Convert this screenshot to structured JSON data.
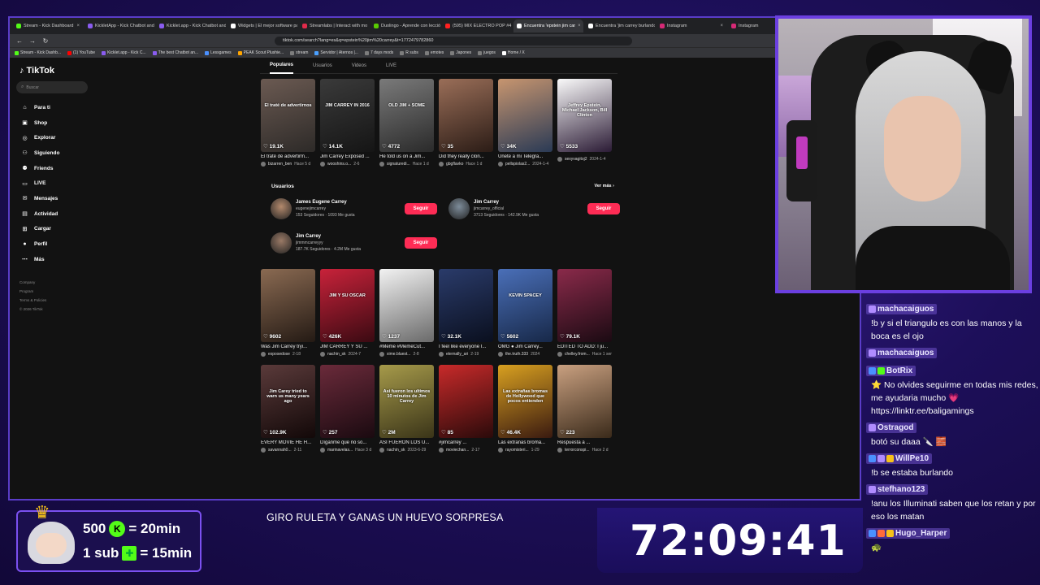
{
  "browser": {
    "tabs": [
      {
        "label": "Stream - Kick Dashboard",
        "color": "#53fc18"
      },
      {
        "label": "KickletApp - Kick Chatbot and",
        "color": "#8a5cf0"
      },
      {
        "label": "Kicklet.app - Kick Chatbot and",
        "color": "#8a5cf0"
      },
      {
        "label": "Widgets | El mejor software pa",
        "color": "#ffffff"
      },
      {
        "label": "Streamlabs | Interact with mo",
        "color": "#e02a4a"
      },
      {
        "label": "Duolingo - Aprende con lecció",
        "color": "#58cc02"
      },
      {
        "label": "(595) MIX ELECTRO POP #4 (S",
        "color": "#ff2020"
      },
      {
        "label": "Encuentra 'epstein jim car",
        "color": "#ffffff",
        "active": true
      },
      {
        "label": "Encuentra 'jim carrey burlando",
        "color": "#ffffff"
      },
      {
        "label": "Instagram",
        "color": "#d62976"
      },
      {
        "label": "Instagram",
        "color": "#d62976"
      }
    ],
    "url": "tiktok.com/search?lang=es&q=epstein%20jim%20carrey&t=1772479782860",
    "nav": {
      "back": "←",
      "forward": "→",
      "reload": "↻"
    },
    "bookmarks": [
      {
        "label": "Stream - Kick Dashb..."
      },
      {
        "label": "(1) YouTube"
      },
      {
        "label": "Kicklet.app - Kick C..."
      },
      {
        "label": "The best Chatbot an..."
      },
      {
        "label": "Lessgames"
      },
      {
        "label": "PEAK Scout Plushie..."
      },
      {
        "label": "stream"
      },
      {
        "label": "Servidor | Aternos |..."
      },
      {
        "label": "7 days mods"
      },
      {
        "label": "R subs"
      },
      {
        "label": "emotes"
      },
      {
        "label": "Japones"
      },
      {
        "label": "juegos"
      },
      {
        "label": "Home / X"
      }
    ]
  },
  "tiktok": {
    "logo": "TikTok",
    "search_placeholder": "Buscar",
    "nav": [
      {
        "label": "Para ti",
        "icon": "home-icon",
        "glyph": "⌂"
      },
      {
        "label": "Shop",
        "icon": "shop-icon",
        "glyph": "▣"
      },
      {
        "label": "Explorar",
        "icon": "compass-icon",
        "glyph": "◎"
      },
      {
        "label": "Siguiendo",
        "icon": "following-icon",
        "glyph": "⚇"
      },
      {
        "label": "Friends",
        "icon": "friends-icon",
        "glyph": "⚉"
      },
      {
        "label": "LIVE",
        "icon": "live-icon",
        "glyph": "▭"
      },
      {
        "label": "Mensajes",
        "icon": "messages-icon",
        "glyph": "✉"
      },
      {
        "label": "Actividad",
        "icon": "activity-icon",
        "glyph": "▤"
      },
      {
        "label": "Cargar",
        "icon": "upload-icon",
        "glyph": "⊞"
      },
      {
        "label": "Perfil",
        "icon": "profile-icon",
        "glyph": "●"
      },
      {
        "label": "Más",
        "icon": "more-icon",
        "glyph": "⋯"
      }
    ],
    "footer": [
      "Company",
      "Program",
      "Terms & Policies",
      "© 2026 TikTok"
    ],
    "tabs": [
      "Populares",
      "Usuarios",
      "Videos",
      "LIVE"
    ],
    "row1": [
      {
        "count": "19.1K",
        "title": "El traté de advertirm...",
        "author": "bizarren_ben",
        "date": "Hace 5 d",
        "overlay": "El traté de advertirnos",
        "c1": "#6b5a52",
        "c2": "#2d2a28"
      },
      {
        "count": "14.1K",
        "title": "Jim Carrey Exposed ...",
        "author": "wooshins.o...",
        "date": "2-6",
        "overlay": "JIM CARREY IN 2016",
        "c1": "#3a3a3a",
        "c2": "#151515"
      },
      {
        "count": "4772",
        "title": "He told us on a Jim...",
        "author": "signaturedi...",
        "date": "Hace 1 d",
        "overlay": "OLD JIM + SOME",
        "c1": "#7a7a7a",
        "c2": "#2a2a2a"
      },
      {
        "count": "35",
        "title": "Did they really clon...",
        "author": "gbgflavko",
        "date": "Hace 1 d",
        "overlay": "",
        "c1": "#9a6e58",
        "c2": "#2b1c16"
      },
      {
        "count": "34K",
        "title": "Únete a mi Telegra...",
        "author": "pellspiolas2...",
        "date": "2024-1-4",
        "overlay": "",
        "c1": "#c7956f",
        "c2": "#2a3a55"
      },
      {
        "count": "5533",
        "title": "",
        "author": "sexyvagitoj2",
        "date": "2024-1-4",
        "overlay": "Jeffrey Epstein, Michael Jackson, Bill Clinton",
        "c1": "#fafafa",
        "c2": "#2b1b35"
      }
    ],
    "users_heading": "Usuarios",
    "users_more": "Ver más",
    "users": [
      {
        "name": "James Eugene Carrey",
        "handle": "eugenejimcarrey",
        "stats": "153 Seguidores · 1093 Me gusta",
        "follow": "Seguir",
        "color": "#b48a6d"
      },
      {
        "name": "Jim Carrey",
        "handle": "jimcarrey_official",
        "stats": "3713 Seguidores · 142.9K Me gusta",
        "follow": "Seguir",
        "color": "#7d8c9a"
      },
      {
        "name": "Jim Carrey",
        "handle": "jimmmcarreyyy",
        "stats": "187.7K Seguidores · 4.2M Me gusta",
        "follow": "Seguir",
        "color": "#9a7a66"
      }
    ],
    "row2": [
      {
        "count": "9602",
        "title": "Was Jim Carrey tryi...",
        "author": "exposedose",
        "date": "2-18",
        "overlay": "",
        "c1": "#8a6a52",
        "c2": "#241a14"
      },
      {
        "count": "426K",
        "title": "JIM CARREY Y SU ...",
        "author": "nachin_sk",
        "date": "2024-7",
        "overlay": "JIM Y SU OSCAR",
        "c1": "#c8223a",
        "c2": "#3a0a12"
      },
      {
        "count": "1237",
        "title": "#Meme #MemeCut...",
        "author": "xime.bluest...",
        "date": "2-8",
        "overlay": "",
        "c1": "#f2f2f2",
        "c2": "#6a6a6a"
      },
      {
        "count": "32.1K",
        "title": "I feel like everyone I...",
        "author": "eternally_ari",
        "date": "2-19",
        "overlay": "",
        "c1": "#2a3b6a",
        "c2": "#0a0f1e"
      },
      {
        "count": "5602",
        "title": "OMG ● Jim Carrey...",
        "author": "the.truth.333",
        "date": "2024",
        "overlay": "KEVIN SPACEY",
        "c1": "#4a6fb8",
        "c2": "#172848"
      },
      {
        "count": "79.1K",
        "title": "EDITED TO ADD: I ju...",
        "author": "chelley.from...",
        "date": "Hace 1 sem",
        "overlay": "",
        "c1": "#8a2a4a",
        "c2": "#1a0a12"
      }
    ],
    "row3": [
      {
        "count": "102.9K",
        "title": "EVERY MOVIE HE H...",
        "author": "savannah0...",
        "date": "2-11",
        "overlay": "Jim Carey tried to warn us many years ago",
        "c1": "#5a3a3a",
        "c2": "#120808"
      },
      {
        "count": "257",
        "title": "Díganme que no so...",
        "author": "marinavelas...",
        "date": "Hace 3 d",
        "overlay": "",
        "c1": "#6a2a3a",
        "c2": "#1a0a10"
      },
      {
        "count": "2M",
        "title": "ASÍ FUERON LOS U...",
        "author": "nachin_sk",
        "date": "2023-6-29",
        "overlay": "Asi fueron los ultimos 10 minutos de Jim Carrey",
        "c1": "#a69a4a",
        "c2": "#3a3418"
      },
      {
        "count": "85",
        "title": "#jimcarrey ...",
        "author": "moviechan...",
        "date": "2-17",
        "overlay": "",
        "c1": "#c82a2a",
        "c2": "#2a0a0a"
      },
      {
        "count": "46.4K",
        "title": "Las extrañas broma...",
        "author": "rayomisteri...",
        "date": "1-29",
        "overlay": "Las extrañas bromas de Hollywood que pocos entienden",
        "c1": "#d8a020",
        "c2": "#3a1a10"
      },
      {
        "count": "223",
        "title": "Respuesta a ...",
        "author": "terrorconspi...",
        "date": "Hace 2 d",
        "overlay": "",
        "c1": "#c9a080",
        "c2": "#3a2a1a"
      }
    ]
  },
  "chat": [
    {
      "user": "machacaiguos",
      "text": "!b y si el triangulo es con las manos y la boca es el ojo",
      "badges": [
        "#b08cff"
      ]
    },
    {
      "user": "machacaiguos",
      "text": "",
      "badges": [
        "#b08cff"
      ]
    },
    {
      "user": "BotRix",
      "text": "⭐ No olvides seguirme en todas mis redes, me ayudaria mucho 💗 https://linktr.ee/baligamings",
      "badges": [
        "#4a90ff",
        "#53fc18"
      ]
    },
    {
      "user": "Ostragod",
      "text": "botó su daaa 🔪 🧱",
      "badges": [
        "#b08cff"
      ]
    },
    {
      "user": "WillPe10",
      "text": "!b se estaba burlando",
      "badges": [
        "#4a90ff",
        "#b08cff",
        "#f6c21a"
      ]
    },
    {
      "user": "stefhano123",
      "text": "!anu los Illuminati saben que los retan y por eso los matan",
      "badges": [
        "#b08cff"
      ]
    },
    {
      "user": "Hugo_Harper",
      "text": "🐢",
      "badges": [
        "#4a90ff",
        "#ff6a3a",
        "#f6c21a"
      ]
    }
  ],
  "overlay": {
    "promo_line1_amount": "500",
    "promo_line1_reward": "= 20min",
    "promo_coin": "K",
    "promo_line2_amount": "1 sub",
    "promo_line2_reward": "= 15min",
    "ticker": "GIRO RULETA Y GANAS UN HUEVO SORPRESA",
    "timer": "72:09:41"
  }
}
